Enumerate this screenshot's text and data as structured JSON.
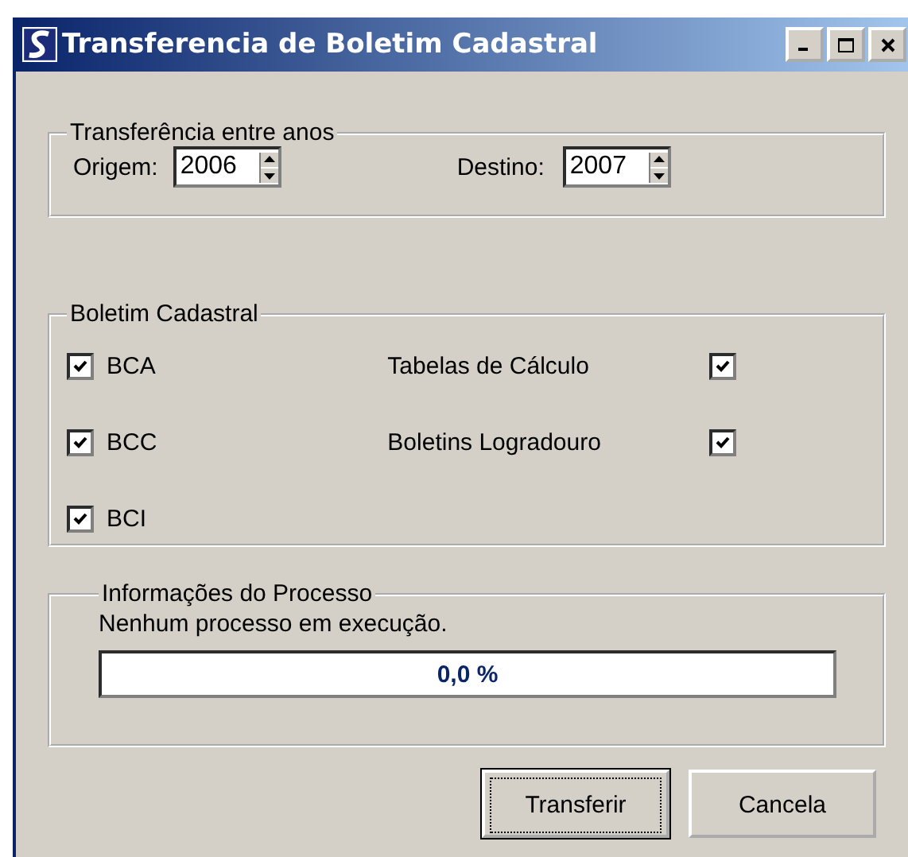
{
  "window": {
    "title": "Transferencia de Boletim Cadastral"
  },
  "transfer_years": {
    "title": "Transferência entre anos",
    "origin": {
      "label": "Origem:",
      "value": "2006"
    },
    "destination": {
      "label": "Destino:",
      "value": "2007"
    }
  },
  "bulletin": {
    "title": "Boletim Cadastral",
    "left": [
      {
        "label": "BCA",
        "checked": true
      },
      {
        "label": "BCC",
        "checked": true
      },
      {
        "label": "BCI",
        "checked": true
      }
    ],
    "right": [
      {
        "label": "Tabelas de Cálculo",
        "checked": true
      },
      {
        "label": "Boletins Logradouro",
        "checked": true
      }
    ]
  },
  "process": {
    "title": "Informações do Processo",
    "status": "Nenhum processo em execução.",
    "level": 0,
    "reading": "0,0 %"
  },
  "buttons": [
    {
      "label": "Transferir",
      "focused": true
    },
    {
      "label": "Cancela",
      "focused": false
    }
  ]
}
